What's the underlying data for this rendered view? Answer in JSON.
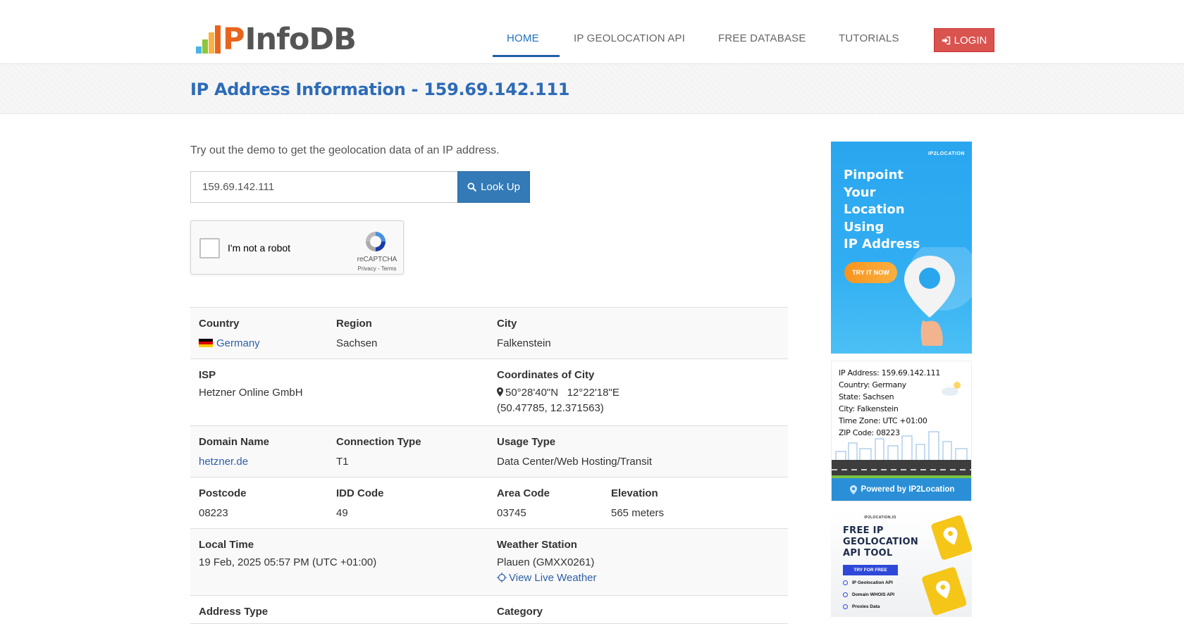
{
  "header": {
    "logo_text": "PInfoDB",
    "logo_p": "P",
    "logo_rest": "InfoDB",
    "nav": [
      {
        "label": "HOME",
        "active": true
      },
      {
        "label": "IP GEOLOCATION API",
        "active": false
      },
      {
        "label": "FREE DATABASE",
        "active": false
      },
      {
        "label": "TUTORIALS",
        "active": false
      }
    ],
    "login_label": "LOGIN"
  },
  "title": "IP Address Information - 159.69.142.111",
  "demo": {
    "intro": "Try out the demo to get the geolocation data of an IP address.",
    "ip_value": "159.69.142.111",
    "lookup_label": "Look Up",
    "captcha_label": "I'm not a robot",
    "captcha_brand": "reCAPTCHA",
    "captcha_terms": "Privacy - Terms"
  },
  "info": {
    "country_label": "Country",
    "country_value": "Germany",
    "region_label": "Region",
    "region_value": "Sachsen",
    "city_label": "City",
    "city_value": "Falkenstein",
    "isp_label": "ISP",
    "isp_value": "Hetzner Online GmbH",
    "coords_label": "Coordinates of City",
    "coords_dms": "50°28'40\"N   12°22'18\"E",
    "coords_decimal": "(50.47785, 12.371563)",
    "domain_label": "Domain Name",
    "domain_value": "hetzner.de",
    "connection_label": "Connection Type",
    "connection_value": "T1",
    "usage_label": "Usage Type",
    "usage_value": "Data Center/Web Hosting/Transit",
    "postcode_label": "Postcode",
    "postcode_value": "08223",
    "idd_label": "IDD Code",
    "idd_value": "49",
    "area_label": "Area Code",
    "area_value": "03745",
    "elevation_label": "Elevation",
    "elevation_value": "565 meters",
    "localtime_label": "Local Time",
    "localtime_value": "19 Feb, 2025 05:57 PM (UTC +01:00)",
    "weather_label": "Weather Station",
    "weather_value": "Plauen (GMXX0261)",
    "weather_link": "View Live Weather",
    "address_type_label": "Address Type",
    "category_label": "Category"
  },
  "ads": {
    "ad1_brand": "IP2LOCATION",
    "ad1_headline": "Pinpoint\nYour\nLocation\nUsing\nIP Address",
    "ad1_cta": "TRY IT NOW",
    "ad2_lines": [
      "IP Address: 159.69.142.111",
      "Country: Germany",
      "State: Sachsen",
      "City: Falkenstein",
      "Time Zone: UTC +01:00",
      "ZIP Code: 08223"
    ],
    "ad2_footer": "Powered by IP2Location",
    "ad3_brand": "IP2LOCATION.IO",
    "ad3_headline": "FREE IP\nGEOLOCATION\nAPI TOOL",
    "ad3_cta": "TRY FOR FREE",
    "ad3_features": [
      "IP Geolocation API",
      "Domain WHOIS API",
      "Proxies Data"
    ]
  },
  "colors": {
    "brand_blue": "#2d6bb8",
    "login_red": "#d9534f",
    "button_blue": "#337ab7",
    "flag": [
      "#000000",
      "#dd0000",
      "#ffce00"
    ]
  }
}
